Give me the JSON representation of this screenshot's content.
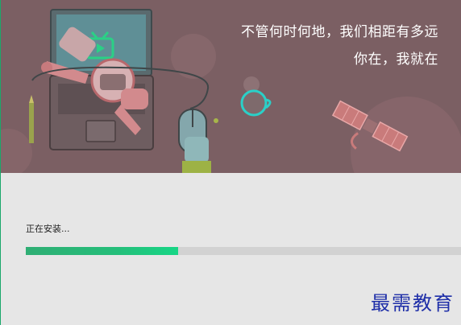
{
  "banner": {
    "slogan_line1": "不管何时何地，我们相距有多远",
    "slogan_line2": "你在，我就在"
  },
  "install": {
    "status_text": "正在安装...",
    "progress_fraction": 0.35
  },
  "watermark": {
    "text": "最需教育"
  },
  "colors": {
    "banner_bg": "#7b5f63",
    "progress_fill": "#1fcf84",
    "progress_track": "#d2d2d2",
    "content_bg": "#e6e6e6",
    "watermark": "#1f2fa8"
  },
  "icons": [
    "tv-icon",
    "astronaut-illustration",
    "laptop-illustration",
    "mouse-icon",
    "satellite-icon",
    "coffee-cup-icon",
    "pencil-icon"
  ]
}
